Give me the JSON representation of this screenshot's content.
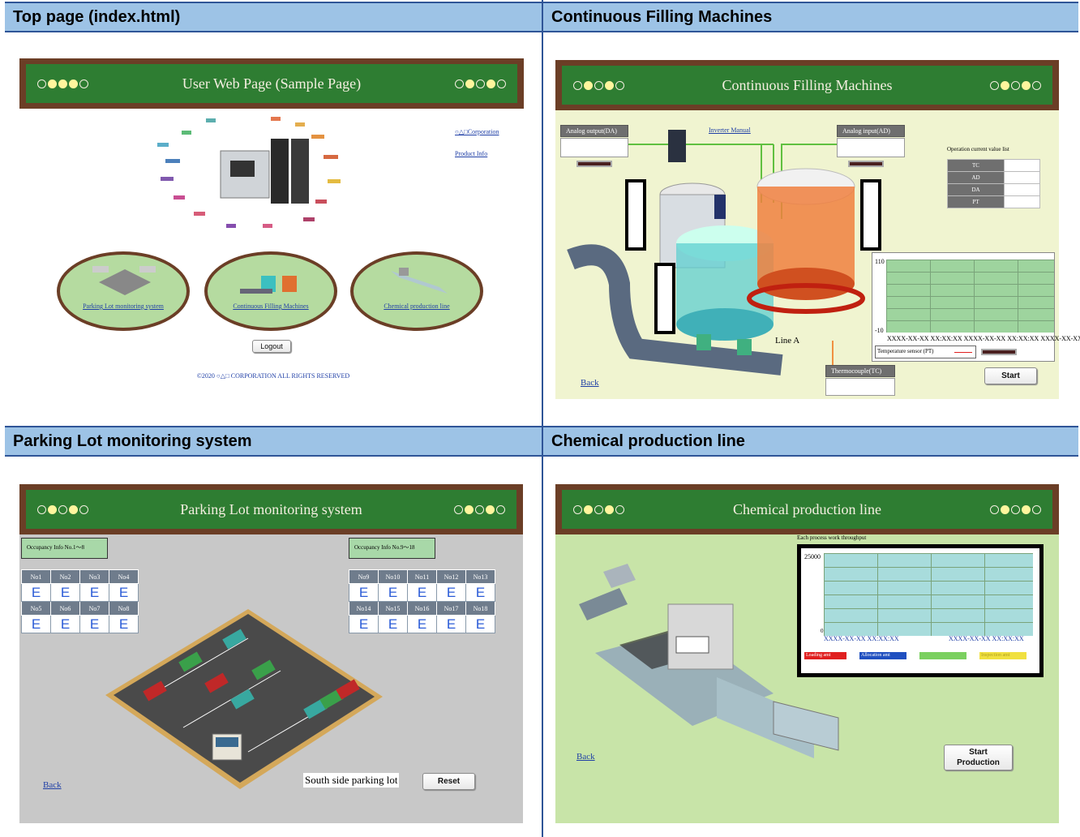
{
  "headers": {
    "top": "Top page (index.html)",
    "filling": "Continuous Filling Machines",
    "parking": "Parking Lot monitoring system",
    "chemical": "Chemical production line"
  },
  "top_page": {
    "title": "User Web Page (Sample Page)",
    "links": {
      "corporation": "○△□Corporation",
      "product_info": "Product Info"
    },
    "menu": [
      "Parking Lot monitoring system",
      "Continuous Filling Machines",
      "Chemical production line"
    ],
    "logout": "Logout",
    "copyright": "©2020 ○△□ CORPORATION ALL RIGHTS RESERVED"
  },
  "filling": {
    "title": "Continuous Filling Machines",
    "analog_output": "Analog output(DA)",
    "analog_input": "Analog input(AD)",
    "inverter_link": "Inverter Manual",
    "value_list_title": "Operation current value list",
    "value_rows": [
      "TC",
      "AD",
      "DA",
      "PT"
    ],
    "y_max": "110",
    "y_min": "-10",
    "x_labels": [
      "XXXX-XX-XX XX:XX:XX",
      "XXXX-XX-XX XX:XX:XX",
      "XXXX-XX-XX XX:XX:XX"
    ],
    "legend": "Temperature sensor (PT)",
    "line_label": "Line A",
    "thermocouple": "Thermocouple(TC)",
    "start": "Start",
    "back": "Back"
  },
  "parking": {
    "title": "Parking Lot monitoring system",
    "occ1": "Occupancy Info No.1～8",
    "occ2": "Occupancy Info No.9～18",
    "left_top_labels": [
      "No1",
      "No2",
      "No3",
      "No4"
    ],
    "left_bottom_labels": [
      "No5",
      "No6",
      "No7",
      "No8"
    ],
    "right_top_labels": [
      "No9",
      "No10",
      "No11",
      "No12",
      "No13"
    ],
    "right_bottom_labels": [
      "No14",
      "No15",
      "No16",
      "No17",
      "No18"
    ],
    "status": "E",
    "lot_name": "South side parking lot",
    "reset": "Reset",
    "back": "Back"
  },
  "chemical": {
    "title": "Chemical production line",
    "chart_title": "Each process work throughput",
    "y_max": "25000",
    "y_min": "0",
    "x_labels": [
      "XXXX-XX-XX XX:XX:XX",
      "XXXX-XX-XX XX:XX:XX"
    ],
    "legend": [
      "Loading amt",
      "Allocation amt",
      "",
      "Inspection amt"
    ],
    "legend_colors": [
      "#e02020",
      "#2050c0",
      "#7bd060",
      "#f0e040"
    ],
    "start_line1": "Start",
    "start_line2": "Production",
    "back": "Back"
  }
}
